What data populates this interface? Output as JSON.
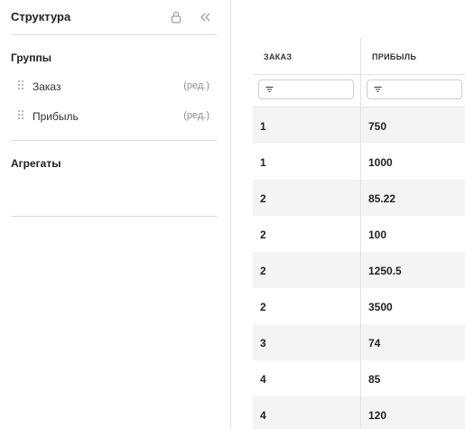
{
  "panel": {
    "title": "Структура",
    "groups_title": "Группы",
    "groups": [
      {
        "label": "Заказ",
        "edit_label": "(ред.)"
      },
      {
        "label": "Прибыль",
        "edit_label": "(ред.)"
      }
    ],
    "aggregates_title": "Агрегаты",
    "icons": [
      "lock-icon",
      "double-chevron-left-icon",
      "drag-handle-icon"
    ]
  },
  "table": {
    "columns": [
      "ЗАКАЗ",
      "ПРИБЫЛЬ"
    ],
    "filters": [
      {
        "value": "",
        "icon": "filter-icon"
      },
      {
        "value": "",
        "icon": "filter-icon"
      }
    ],
    "rows": [
      [
        "1",
        "750"
      ],
      [
        "1",
        "1000"
      ],
      [
        "2",
        "85.22"
      ],
      [
        "2",
        "100"
      ],
      [
        "2",
        "1250.5"
      ],
      [
        "2",
        "3500"
      ],
      [
        "3",
        "74"
      ],
      [
        "4",
        "85"
      ],
      [
        "4",
        "120"
      ]
    ],
    "stripe_color": "#f4f4f5"
  }
}
